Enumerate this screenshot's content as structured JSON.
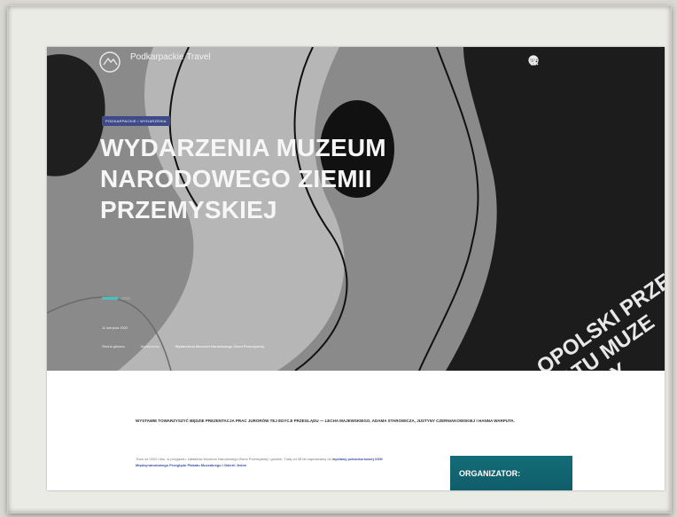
{
  "header": {
    "brand": "Podkarpackie Travel",
    "nav_icons": [
      "accessibility-icon",
      "language-icon",
      "search-icon",
      "menu-icon"
    ]
  },
  "hero": {
    "tag": "PODKARPACKIE / WYDARZENIA",
    "title": "WYDARZENIA MUZEUM NARODOWEGO ZIEMII PRZEMYSKIEJ",
    "date": "11 sierpnia 2022",
    "breadcrumbs": [
      "Strona główna",
      "Wydarzenia",
      "Wydarzenia Muzeum Narodowego Ziemi Przemyskiej"
    ],
    "poster_text_lines": [
      "OPOLSKI PRZE",
      "ATU MUZE",
      "ONY"
    ]
  },
  "content": {
    "lead": "WYSTAWIE TOWARZYSZYĆ BĘDZIE PREZENTACJA PRAC JURORÓW TEJ EDYCJI PRZEGLĄDU — LECHA MAJEWSKIEGO, ADAMA STAROWICZA, JUSTYNY CZERNIAKOWSKIEJ I HANNA WARPUTA.",
    "body_prefix": "Trwa od 2022 roku, w przyjazdu: zakładów Muzeum Narodowego Ziemi Przemyskiej i gorzkie. Tutaj od 28 lat zapraszamy do",
    "body_link": "wystawy pokonkursowej XXIII Międzynarodowego Przeglądu Plakatu Muzealnego i Galerii Jedne"
  },
  "organizer": {
    "label": "ORGANIZATOR:"
  },
  "colors": {
    "accent_teal": "#45c2bb",
    "tag_blue": "#3f4b89",
    "organizer_teal": "#146c78"
  }
}
